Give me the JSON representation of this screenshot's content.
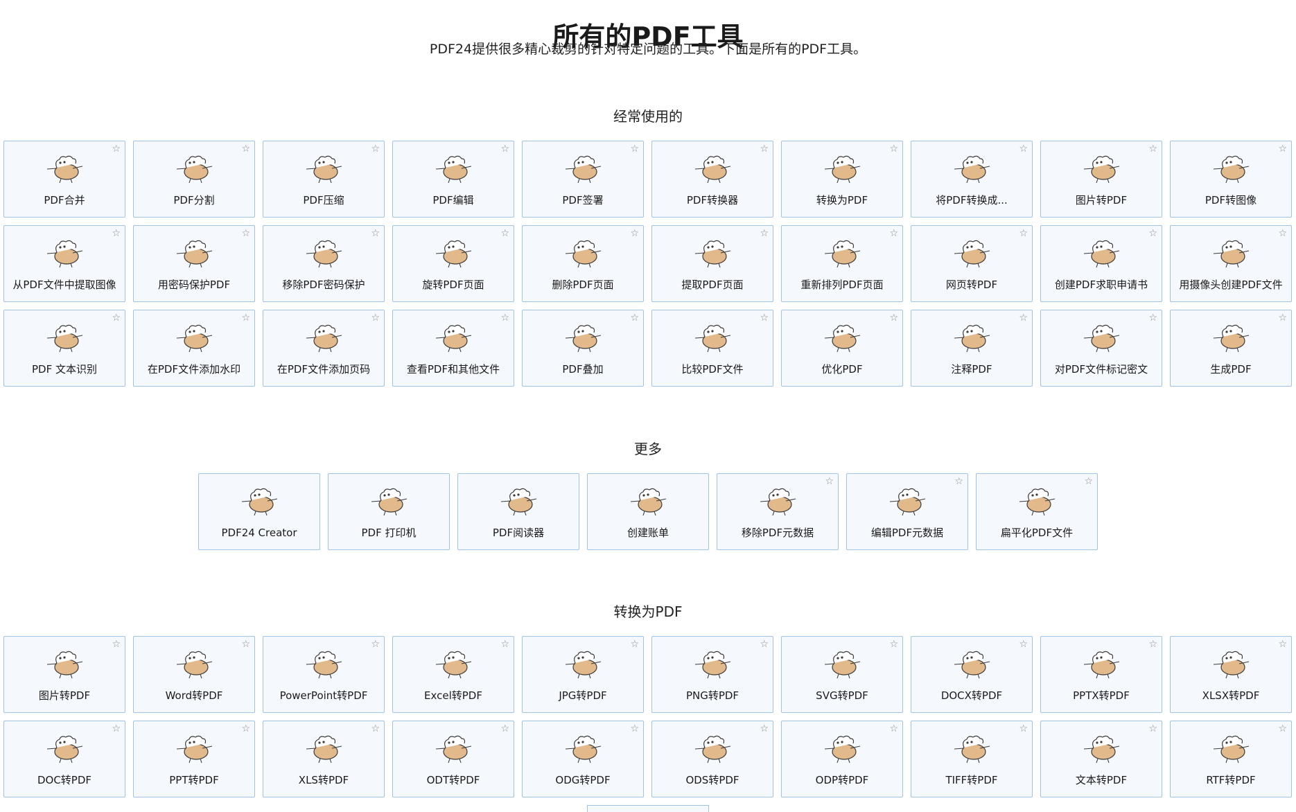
{
  "header": {
    "title": "所有的PDF工具",
    "subtitle": "PDF24提供很多精心裁剪的针对特定问题的工具。下面是所有的PDF工具。"
  },
  "icons": {
    "star": "star-outline-icon",
    "mascot": "sheep-mascot-icon"
  },
  "colors": {
    "tile_bg": "#f5f8fc",
    "tile_border": "#9fc3e2",
    "mascot_body": "#e2b98a",
    "mascot_line": "#3a3a3a"
  },
  "sections": {
    "common": {
      "heading": "经常使用的",
      "tools": [
        {
          "label": "PDF合并",
          "star": "☆"
        },
        {
          "label": "PDF分割",
          "star": "☆"
        },
        {
          "label": "PDF压缩",
          "star": "☆"
        },
        {
          "label": "PDF编辑",
          "star": "☆"
        },
        {
          "label": "PDF签署",
          "star": "☆"
        },
        {
          "label": "PDF转换器",
          "star": "☆"
        },
        {
          "label": "转换为PDF",
          "star": "☆"
        },
        {
          "label": "将PDF转换成...",
          "star": "☆"
        },
        {
          "label": "图片转PDF",
          "star": "☆"
        },
        {
          "label": "PDF转图像",
          "star": "☆"
        },
        {
          "label": "从PDF文件中提取图像",
          "star": "☆"
        },
        {
          "label": "用密码保护PDF",
          "star": "☆"
        },
        {
          "label": "移除PDF密码保护",
          "star": "☆"
        },
        {
          "label": "旋转PDF页面",
          "star": "☆"
        },
        {
          "label": "删除PDF页面",
          "star": "☆"
        },
        {
          "label": "提取PDF页面",
          "star": "☆"
        },
        {
          "label": "重新排列PDF页面",
          "star": "☆"
        },
        {
          "label": "网页转PDF",
          "star": "☆"
        },
        {
          "label": "创建PDF求职申请书",
          "star": "☆"
        },
        {
          "label": "用摄像头创建PDF文件",
          "star": "☆"
        },
        {
          "label": "PDF 文本识别",
          "star": "☆"
        },
        {
          "label": "在PDF文件添加水印",
          "star": "☆"
        },
        {
          "label": "在PDF文件添加页码",
          "star": "☆"
        },
        {
          "label": "查看PDF和其他文件",
          "star": "☆"
        },
        {
          "label": "PDF叠加",
          "star": "☆"
        },
        {
          "label": "比较PDF文件",
          "star": "☆"
        },
        {
          "label": "优化PDF",
          "star": "☆"
        },
        {
          "label": "注释PDF",
          "star": "☆"
        },
        {
          "label": "对PDF文件标记密文",
          "star": "☆"
        },
        {
          "label": "生成PDF",
          "star": "☆"
        }
      ]
    },
    "more": {
      "heading": "更多",
      "tools": [
        {
          "label": "PDF24 Creator",
          "star": ""
        },
        {
          "label": "PDF 打印机",
          "star": ""
        },
        {
          "label": "PDF阅读器",
          "star": ""
        },
        {
          "label": "创建账单",
          "star": ""
        },
        {
          "label": "移除PDF元数据",
          "star": "☆"
        },
        {
          "label": "编辑PDF元数据",
          "star": "☆"
        },
        {
          "label": "扁平化PDF文件",
          "star": "☆"
        }
      ]
    },
    "to_pdf": {
      "heading": "转换为PDF",
      "tools": [
        {
          "label": "图片转PDF",
          "star": "☆"
        },
        {
          "label": "Word转PDF",
          "star": "☆"
        },
        {
          "label": "PowerPoint转PDF",
          "star": "☆"
        },
        {
          "label": "Excel转PDF",
          "star": "☆"
        },
        {
          "label": "JPG转PDF",
          "star": "☆"
        },
        {
          "label": "PNG转PDF",
          "star": "☆"
        },
        {
          "label": "SVG转PDF",
          "star": "☆"
        },
        {
          "label": "DOCX转PDF",
          "star": "☆"
        },
        {
          "label": "PPTX转PDF",
          "star": "☆"
        },
        {
          "label": "XLSX转PDF",
          "star": "☆"
        },
        {
          "label": "DOC转PDF",
          "star": "☆"
        },
        {
          "label": "PPT转PDF",
          "star": "☆"
        },
        {
          "label": "XLS转PDF",
          "star": "☆"
        },
        {
          "label": "ODT转PDF",
          "star": "☆"
        },
        {
          "label": "ODG转PDF",
          "star": "☆"
        },
        {
          "label": "ODS转PDF",
          "star": "☆"
        },
        {
          "label": "ODP转PDF",
          "star": "☆"
        },
        {
          "label": "TIFF转PDF",
          "star": "☆"
        },
        {
          "label": "文本转PDF",
          "star": "☆"
        },
        {
          "label": "RTF转PDF",
          "star": "☆"
        }
      ]
    }
  }
}
